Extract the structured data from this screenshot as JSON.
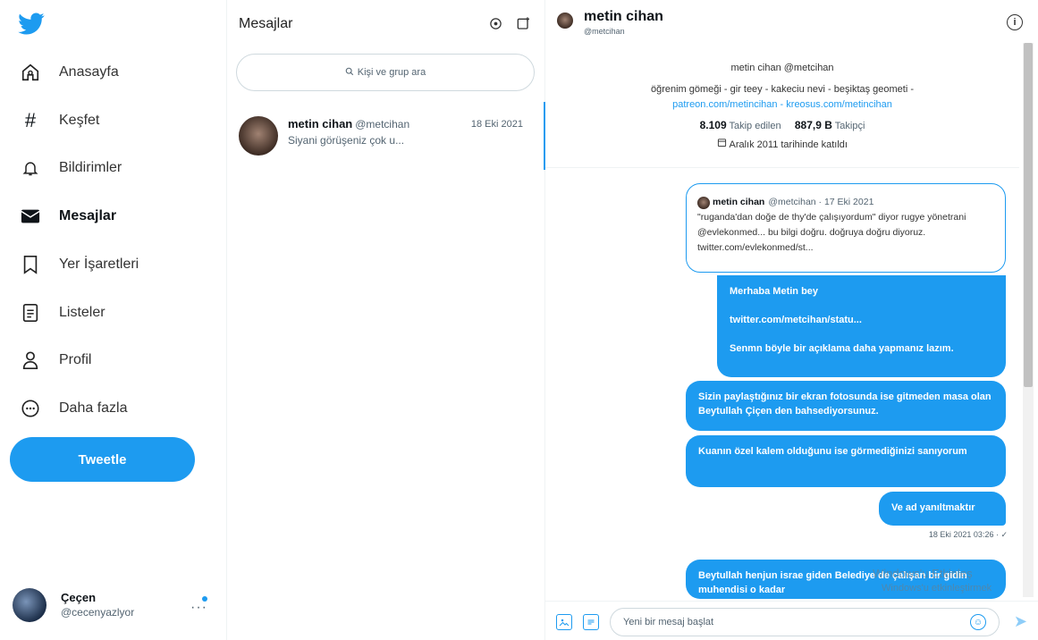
{
  "nav": {
    "items": [
      {
        "label": "Anasayfa",
        "icon": "home-icon"
      },
      {
        "label": "Keşfet",
        "icon": "hashtag-icon"
      },
      {
        "label": "Bildirimler",
        "icon": "bell-icon"
      },
      {
        "label": "Mesajlar",
        "icon": "envelope-icon"
      },
      {
        "label": "Yer İşaretleri",
        "icon": "bookmark-icon"
      },
      {
        "label": "Listeler",
        "icon": "list-icon"
      },
      {
        "label": "Profil",
        "icon": "person-icon"
      },
      {
        "label": "Daha fazla",
        "icon": "more-circle-icon"
      }
    ],
    "tweet_button": "Tweetle",
    "account": {
      "name": "Çeçen",
      "handle": "@cecenyazlyor"
    }
  },
  "list": {
    "title": "Mesajlar",
    "search_placeholder": "Kişi ve grup ara",
    "conversations": [
      {
        "name": "metin cihan",
        "handle": "@metcihan",
        "date": "18 Eki 2021",
        "preview": "Siyani görüşeniz çok u..."
      }
    ]
  },
  "chat": {
    "name": "metin cihan",
    "handle": "@metcihan",
    "profile": {
      "name_line": "metin cihan @metcihan",
      "bio1": "öğrenim gömeği - gir teey - kakeciu nevi - beşiktaş geometi -",
      "bio2": "patreon.com/metincihan - kreosus.com/metincihan",
      "following_count": "8.109",
      "following_label": "Takip edilen",
      "followers_count": "887,9 B",
      "followers_label": "Takipçi",
      "joined": "Aralık 2011 tarihinde katıldı"
    },
    "quote": {
      "name": "metin cihan",
      "meta": "@metcihan · 17 Eki 2021",
      "text": "\"ruganda'dan doğe de thy'de çalışıyordum\" diyor rugye yönetrani @evlekonmed... bu bilgi doğru. doğruya doğru diyoruz. twitter.com/evlekonmed/st..."
    },
    "messages": [
      {
        "lines": [
          "Merhaba Metin bey",
          "twitter.com/metcihan/statu...",
          "Senmn böyle bir açıklama daha yapmanız lazım."
        ]
      },
      {
        "text": "Sizin paylaştığınız bir ekran fotosunda ise gitmeden masa olan Beytullah Çiçen den bahsediyorsunuz."
      },
      {
        "text": "Kuanın özel kalem olduğunu ise görmediğinizi sanıyorum"
      },
      {
        "text": "Ve ad yanıltmaktır"
      },
      {
        "text": "Beytullah henjun israe giden Belediye de çalışan bir gidin muhendisi o kadar"
      }
    ],
    "timestamp": "18 Eki 2021 03:26 · ✓",
    "composer_placeholder": "Yeni bir mesaj başlat"
  },
  "watermark": {
    "line1": "Windows'u Etkinleş",
    "line2": "Windows'u etkinleştirmek"
  },
  "colors": {
    "accent": "#1d9bf0",
    "text": "#0f1419",
    "muted": "#536471"
  }
}
